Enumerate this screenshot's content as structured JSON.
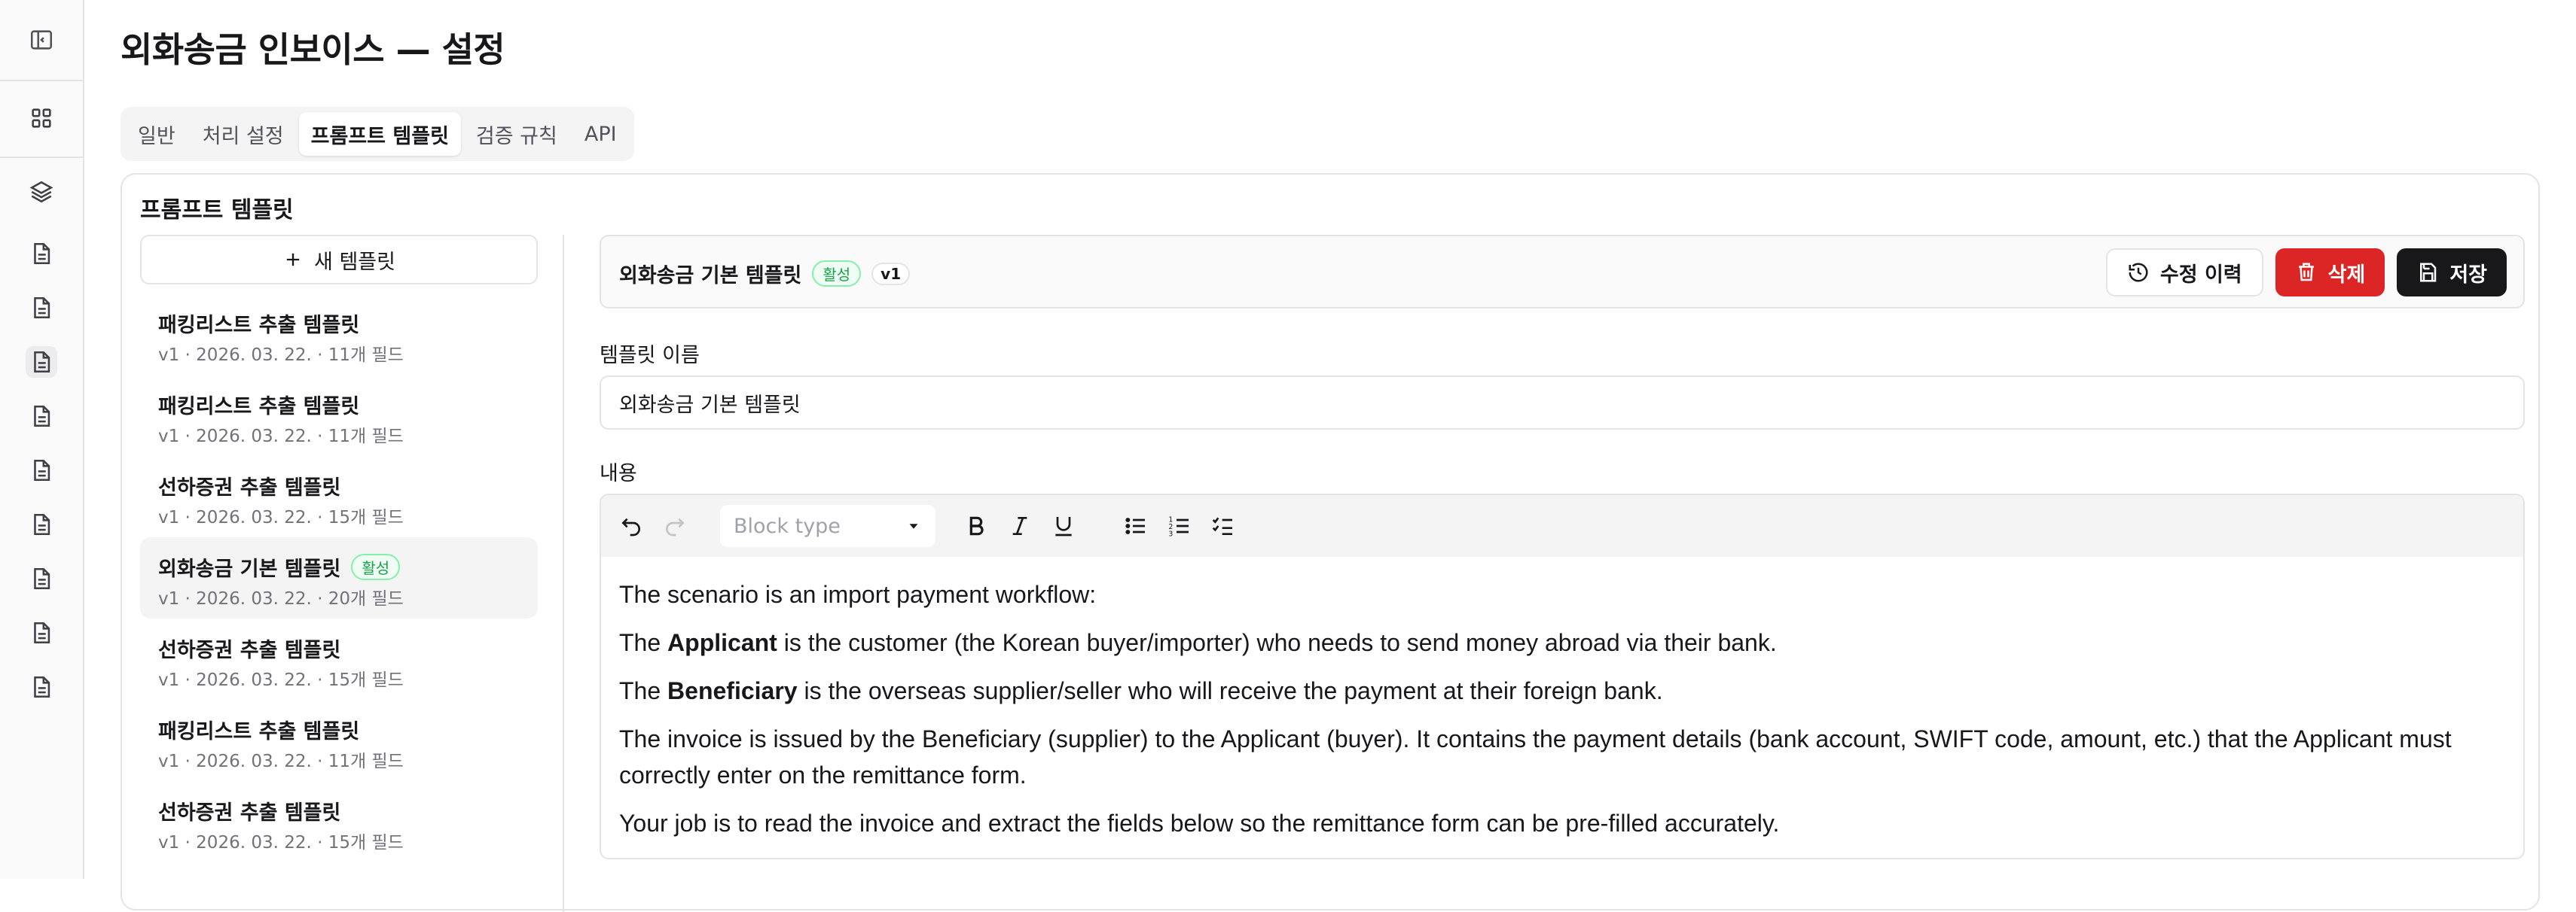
{
  "page": {
    "title": "외화송금 인보이스 — 설정"
  },
  "rail": {
    "icons": [
      "sidebar-toggle-icon",
      "dashboard-icon",
      "layers-icon",
      "document-icon",
      "document-icon",
      "document-icon",
      "document-icon",
      "document-icon",
      "document-icon",
      "document-icon",
      "document-icon",
      "document-icon"
    ]
  },
  "tabs": [
    {
      "label": "일반"
    },
    {
      "label": "처리 설정"
    },
    {
      "label": "프롬프트 템플릿",
      "active": true
    },
    {
      "label": "검증 규칙"
    },
    {
      "label": "API"
    }
  ],
  "card": {
    "title": "프롬프트 템플릿"
  },
  "sidebar": {
    "new_label": "새 템플릿",
    "templates": [
      {
        "name": "패킹리스트 추출 템플릿",
        "meta": "v1 · 2026. 03. 22. · 11개 필드"
      },
      {
        "name": "패킹리스트 추출 템플릿",
        "meta": "v1 · 2026. 03. 22. · 11개 필드"
      },
      {
        "name": "선하증권 추출 템플릿",
        "meta": "v1 · 2026. 03. 22. · 15개 필드"
      },
      {
        "name": "외화송금 기본 템플릿",
        "meta": "v1 · 2026. 03. 22. · 20개 필드",
        "badge": "활성",
        "selected": true
      },
      {
        "name": "선하증권 추출 템플릿",
        "meta": "v1 · 2026. 03. 22. · 15개 필드"
      },
      {
        "name": "패킹리스트 추출 템플릿",
        "meta": "v1 · 2026. 03. 22. · 11개 필드"
      },
      {
        "name": "선하증권 추출 템플릿",
        "meta": "v1 · 2026. 03. 22. · 15개 필드"
      }
    ]
  },
  "editor_header": {
    "name": "외화송금 기본 템플릿",
    "status_badge": "활성",
    "version": "v1",
    "history_label": "수정 이력",
    "delete_label": "삭제",
    "save_label": "저장"
  },
  "form": {
    "name_label": "템플릿 이름",
    "name_value": "외화송금 기본 템플릿",
    "content_label": "내용",
    "block_type_placeholder": "Block type"
  },
  "content": {
    "p1": "The scenario is an import payment workflow:",
    "p2_pre": "The ",
    "p2_bold": "Applicant",
    "p2_post": " is the customer (the Korean buyer/importer) who needs to send money abroad via their bank.",
    "p3_pre": "The ",
    "p3_bold": "Beneficiary",
    "p3_post": " is the overseas supplier/seller who will receive the payment at their foreign bank.",
    "p4": "The invoice is issued by the Beneficiary (supplier) to the Applicant (buyer). It contains the payment details (bank account, SWIFT code, amount, etc.) that the Applicant must correctly enter on the remittance form.",
    "p5": "Your job is to read the invoice and extract the fields below so the remittance form can be pre-filled accurately."
  },
  "colors": {
    "danger": "#dc2626",
    "primary": "#18181b",
    "active_green": "#16a34a"
  }
}
